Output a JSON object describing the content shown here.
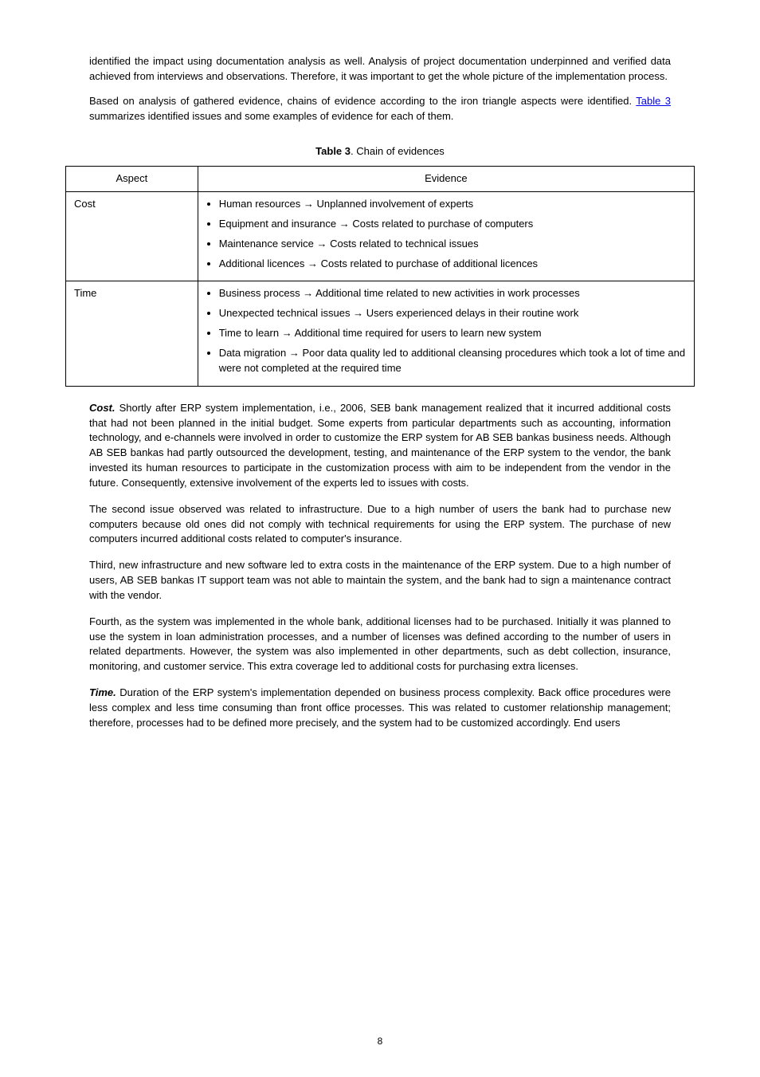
{
  "intro": {
    "p1": "identified the impact using documentation analysis as well. Analysis of project documentation underpinned and verified data achieved from interviews and observations. Therefore, it was important to get the whole picture of the implementation process.",
    "p2_before": "Based on analysis of gathered evidence, chains of evidence according to the iron triangle aspects were identified. ",
    "p2_table_ref": "Table 3",
    "p2_after": " summarizes identified issues and some examples of evidence for each of them."
  },
  "table": {
    "caption_label": "Table 3",
    "caption_text": ". Chain of evidences",
    "headers": {
      "aspect": "Aspect",
      "evidence": "Evidence"
    },
    "rows": [
      {
        "aspect": "Cost",
        "items": [
          {
            "issue": "Human resources",
            "consequence": "Unplanned involvement of experts"
          },
          {
            "issue": "Equipment and insurance",
            "consequence": "Costs related to purchase of computers"
          },
          {
            "issue": "Maintenance service",
            "consequence": "Costs related to technical issues"
          },
          {
            "issue": "Additional licences",
            "consequence": "Costs related to purchase of additional licences"
          }
        ]
      },
      {
        "aspect": "Time",
        "items": [
          {
            "issue": "Business process",
            "consequence": "Additional time related to new activities in work processes"
          },
          {
            "issue": "Unexpected technical issues",
            "consequence": "Users experienced delays in their routine work"
          },
          {
            "issue": "Time to learn",
            "consequence": "Additional time required for users to learn new system"
          },
          {
            "issue": "Data migration",
            "consequence": "Poor data quality led to additional cleansing procedures which took a lot of time and were not completed at the required time"
          }
        ]
      }
    ]
  },
  "body": {
    "p1_label": "Cost.",
    "p1_text": " Shortly after ERP system implementation, i.e., 2006, SEB bank management realized that it incurred additional costs that had not been planned in the initial budget. Some experts from particular departments such as accounting, information technology, and e-channels were involved in order to customize the ERP system for AB SEB bankas business needs. Although AB SEB bankas had partly outsourced the development, testing, and maintenance of the ERP system to the vendor, the bank invested its human resources to participate in the customization process with aim to be independent from the vendor in the future. Consequently, extensive involvement of the experts led to issues with costs.",
    "p2": "The second issue observed was related to infrastructure. Due to a high number of users the bank had to purchase new computers because old ones did not comply with technical requirements for using the ERP system. The purchase of new computers incurred additional costs related to computer's insurance.",
    "p3": "Third, new infrastructure and new software led to extra costs in the maintenance of the ERP system. Due to a high number of users, AB SEB bankas IT support team was not able to maintain the system, and the bank had to sign a maintenance contract with the vendor.",
    "p4": "Fourth, as the system was implemented in the whole bank, additional licenses had to be purchased. Initially it was planned to use the system in loan administration processes, and a number of licenses was defined according to the number of users in related departments. However, the system was also implemented in other departments, such as debt collection, insurance, monitoring, and customer service. This extra coverage led to additional costs for purchasing extra licenses.",
    "p5_label": "Time.",
    "p5_text": " Duration of the ERP system's implementation depended on business process complexity. Back office procedures were less complex and less time consuming than front office processes. This was related to customer relationship management; therefore, processes had to be defined more precisely, and the system had to be customized accordingly. End users"
  },
  "footer": {
    "page_number": "8"
  }
}
